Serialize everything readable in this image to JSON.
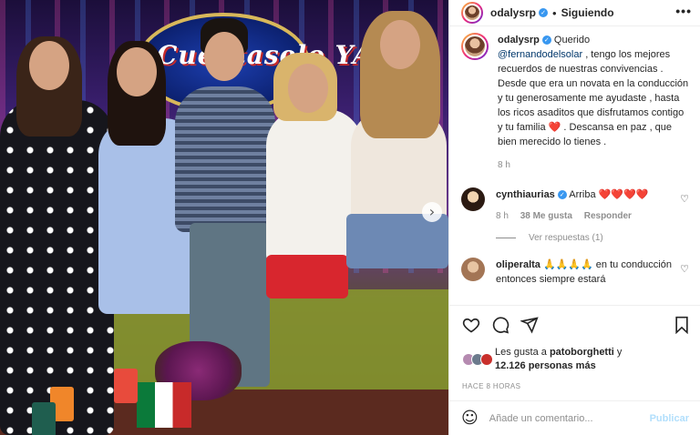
{
  "photo": {
    "sign_text": "Cuéntaselo YA!"
  },
  "post": {
    "author": "odalysrp",
    "follow_status": "Siguiendo",
    "more_icon": "more-horizontal-icon",
    "caption_parts": {
      "intro": "Querido",
      "mention": "@fernandodelsolar",
      "body": ", tengo los mejores recuerdos de nuestras convivencias . Desde que era un novata en la conducción y tu generosamente me ayudaste , hasta los ricos asaditos que disfrutamos contigo y tu familia",
      "heart": "❤️",
      "end": ". Descansa en paz , que bien merecido lo tienes ."
    },
    "caption_time": "8 h"
  },
  "comments": [
    {
      "user": "cynthiaurias",
      "text": "Arriba ❤️❤️❤️❤️",
      "time": "8 h",
      "likes": "38 Me gusta",
      "reply": "Responder",
      "view_replies": "Ver respuestas (1)"
    },
    {
      "user": "oliperalta",
      "text": "🙏🙏🙏🙏 en tu conducción entonces siempre estará"
    }
  ],
  "actions": {
    "liked_by_prefix": "Les gusta a",
    "liked_by_user": "patoborghetti",
    "liked_by_and": "y",
    "liked_by_count": "12.126 personas más",
    "timestamp": "HACE 8 HORAS"
  },
  "comment_box": {
    "placeholder": "Añade un comentario...",
    "publish_label": "Publicar"
  },
  "colors": {
    "verified": "#3897f0",
    "mention": "#00376b",
    "publish_disabled": "#b2dffc",
    "heart": "#e0245e"
  }
}
